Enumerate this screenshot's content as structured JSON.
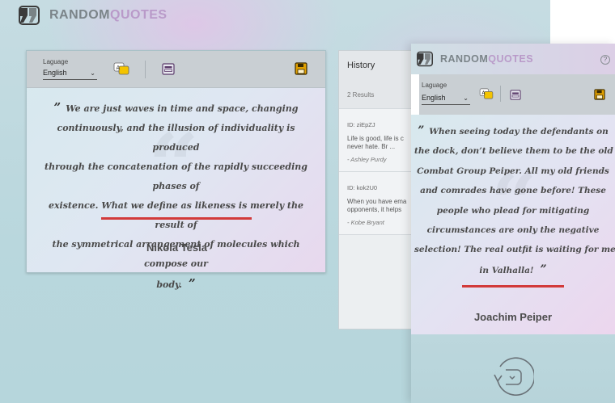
{
  "app": {
    "name_part1": "RANDOM",
    "name_part2": "QUOTES"
  },
  "toolbar": {
    "language_label": "Laguage",
    "language_value": "English",
    "icons": [
      "translate-icon",
      "keyboard-icon",
      "save-icon"
    ]
  },
  "quote": {
    "open_mark": "”",
    "close_mark": "”",
    "lines": [
      "We are just waves in time and space, changing",
      "continuously, and the illusion of individuality is produced",
      "through the concatenation of the rapidly succeeding phases of",
      "existence. What we define as likeness is merely the result of",
      "the symmetrical arrangement of molecules which compose our",
      "body."
    ],
    "author": "Nikola Tesla"
  },
  "history": {
    "title": "History",
    "results": "2 Results",
    "items": [
      {
        "id": "ID: ziEpZJ",
        "line1": "Life is good, life is c",
        "line2": "never hate. Br ...",
        "author": "- Ashley Purdy"
      },
      {
        "id": "ID: kok2U0",
        "line1": "When you have ema",
        "line2": "opponents, it helps",
        "author": "- Kobe Bryant"
      }
    ]
  },
  "mobile": {
    "app_part1": "RANDOM",
    "app_part2": "QUOTES",
    "help": "?",
    "language_label": "Laguage",
    "language_value": "English",
    "quote_lines": [
      "When seeing today the defendants on",
      "the dock, don’t believe them to be the old",
      "Combat Group Peiper. All my old friends",
      "and comrades have gone before! These",
      "people who plead for mitigating",
      "circumstances are only the negative",
      "selection! The real outfit is waiting for me",
      "in Valhalla!"
    ],
    "author": "Joachim Peiper"
  },
  "colors": {
    "accent_underline": "#d23a3a",
    "logo_gray": "#7b8489",
    "logo_purple": "#b99ac9",
    "save_icon": "#e0a000"
  }
}
